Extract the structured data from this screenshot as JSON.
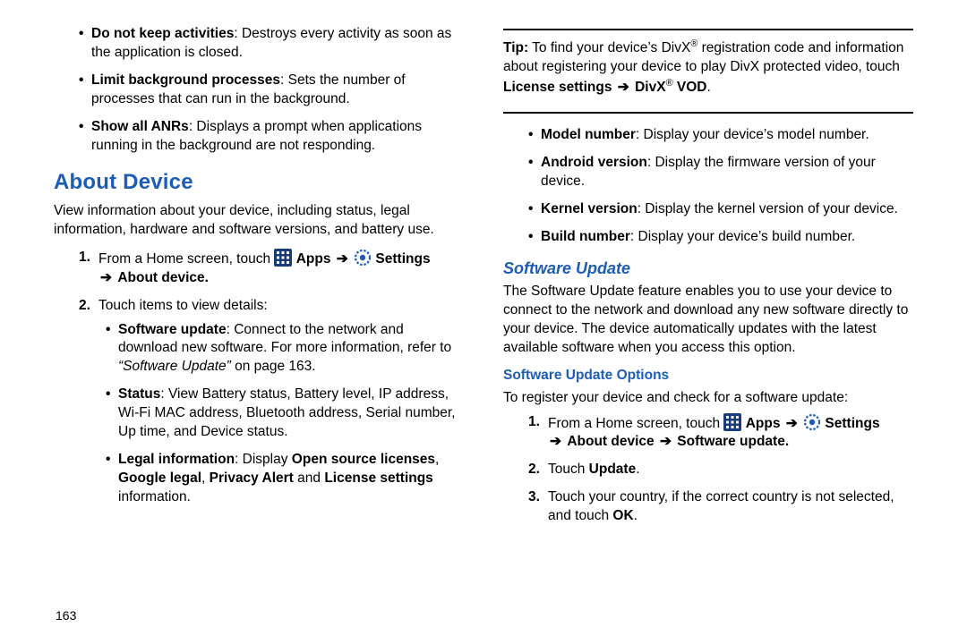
{
  "left": {
    "top_bullets": [
      {
        "label": "Do not keep activities",
        "rest": ": Destroys every activity as soon as the application is closed."
      },
      {
        "label": "Limit background processes",
        "rest": ": Sets the number of processes that can run in the background."
      },
      {
        "label": "Show all ANRs",
        "rest": ": Displays a prompt when applications running in the background are not responding."
      }
    ],
    "heading": "About Device",
    "intro": "View information about your device, including status, legal information, hardware and software versions, and battery use.",
    "step1_pre": "From a Home screen, touch ",
    "apps_label": "Apps",
    "settings_label": "Settings",
    "about_device_label": "About device",
    "step2": "Touch items to view details:",
    "details": {
      "sw_label": "Software update",
      "sw_rest_a": ": Connect to the network and download new software. For more information, refer to ",
      "sw_ref": "“Software Update”",
      "sw_rest_b": " on page 163.",
      "status_label": "Status",
      "status_rest": ": View Battery status, Battery level, IP address, Wi-Fi MAC address, Bluetooth address, Serial number, Up time, and Device status.",
      "legal_label": "Legal information",
      "legal_mid": ": Display ",
      "osl": "Open source licenses",
      "google_legal": "Google legal",
      "privacy_alert": "Privacy Alert",
      "license_settings": "License settings",
      "legal_tail": " information."
    }
  },
  "right": {
    "tip_label": "Tip:",
    "tip_a": " To find your device’s DivX",
    "reg_sup": "®",
    "tip_b": " registration code and information about registering your device to play DivX protected video, touch ",
    "license_settings": "License settings",
    "divx": "DivX",
    "vod": "VOD",
    "info_bullets": [
      {
        "label": "Model number",
        "rest": ": Display your device’s model number."
      },
      {
        "label": "Android version",
        "rest": ": Display the firmware version of your device."
      },
      {
        "label": "Kernel version",
        "rest": ": Display the kernel version of your device."
      },
      {
        "label": "Build number",
        "rest": ": Display your device’s build number."
      }
    ],
    "su_heading": "Software Update",
    "su_intro": "The Software Update feature enables you to use your device to connect to the network and download any new software directly to your device. The device automatically updates with the latest available software when you access this option.",
    "suo_heading": "Software Update Options",
    "suo_intro": "To register your device and check for a software update:",
    "step1_pre": "From a Home screen, touch ",
    "apps_label": "Apps",
    "settings_label": "Settings",
    "about_device_label": "About device",
    "software_update_label": "Software update",
    "step2_a": "Touch ",
    "step2_b": "Update",
    "step3_a": "Touch your country, if the correct country is not selected, and touch ",
    "step3_b": "OK"
  },
  "page_number": "163"
}
